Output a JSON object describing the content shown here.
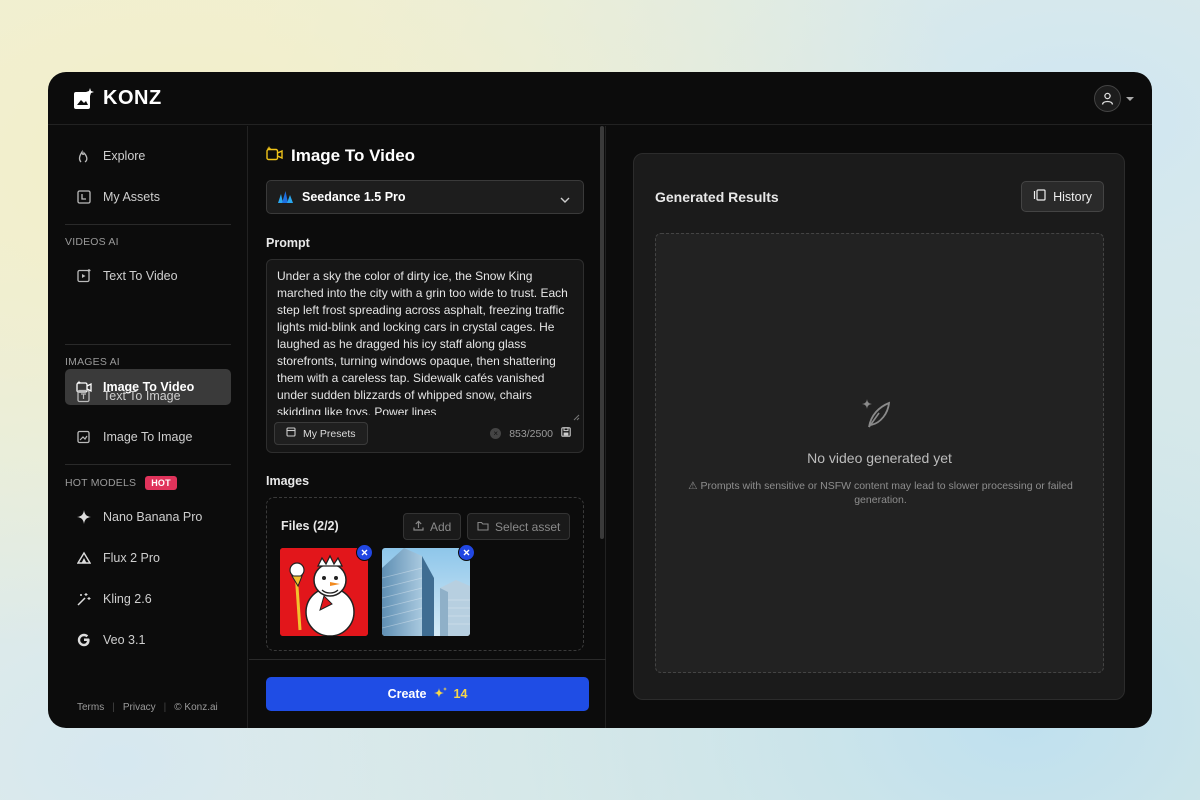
{
  "app": {
    "name": "KONZ"
  },
  "sidebar": {
    "items_top": [
      {
        "label": "Explore",
        "icon": "flame-icon"
      },
      {
        "label": "My Assets",
        "icon": "assets-icon"
      }
    ],
    "videos_section": "VIDEOS AI",
    "videos_items": [
      {
        "label": "Text To Video",
        "icon": "text-video-icon"
      },
      {
        "label": "Image To Video",
        "icon": "image-video-icon",
        "active": true
      }
    ],
    "images_section": "IMAGES AI",
    "images_items": [
      {
        "label": "Text To Image",
        "icon": "text-image-icon"
      },
      {
        "label": "Image To Image",
        "icon": "image-image-icon"
      }
    ],
    "hot_section": "HOT MODELS",
    "hot_badge": "HOT",
    "hot_items": [
      {
        "label": "Nano Banana Pro",
        "icon": "sparkle-icon"
      },
      {
        "label": "Flux 2 Pro",
        "icon": "triangle-icon"
      },
      {
        "label": "Kling 2.6",
        "icon": "magic-wand-icon"
      },
      {
        "label": "Veo 3.1",
        "icon": "google-icon"
      }
    ],
    "footer": {
      "terms": "Terms",
      "privacy": "Privacy",
      "copyright": "© Konz.ai"
    }
  },
  "form": {
    "title": "Image To Video",
    "model": "Seedance 1.5 Pro",
    "prompt_label": "Prompt",
    "prompt_value": "Under a sky the color of dirty ice, the Snow King marched into the city with a grin too wide to trust. Each step left frost spreading across asphalt, freezing traffic lights mid-blink and locking cars in crystal cages. He laughed as he dragged his icy staff along glass storefronts, turning windows opaque, then shattering them with a careless tap. Sidewalk cafés vanished under sudden blizzards of whipped snow, chairs skidding like toys. Power lines",
    "presets_label": "My Presets",
    "char_count": "853/2500",
    "images_label": "Images",
    "files_label": "Files (2/2)",
    "add_label": "Add",
    "select_asset_label": "Select asset",
    "create_label": "Create",
    "create_cost": "14"
  },
  "results": {
    "title": "Generated Results",
    "history_label": "History",
    "empty_title": "No video generated yet",
    "empty_note": "⚠ Prompts with sensitive or NSFW content may lead to slower processing or failed generation."
  },
  "colors": {
    "accent": "#1f4de5",
    "hot": "#e0335b",
    "background": "#0c0c0c"
  }
}
